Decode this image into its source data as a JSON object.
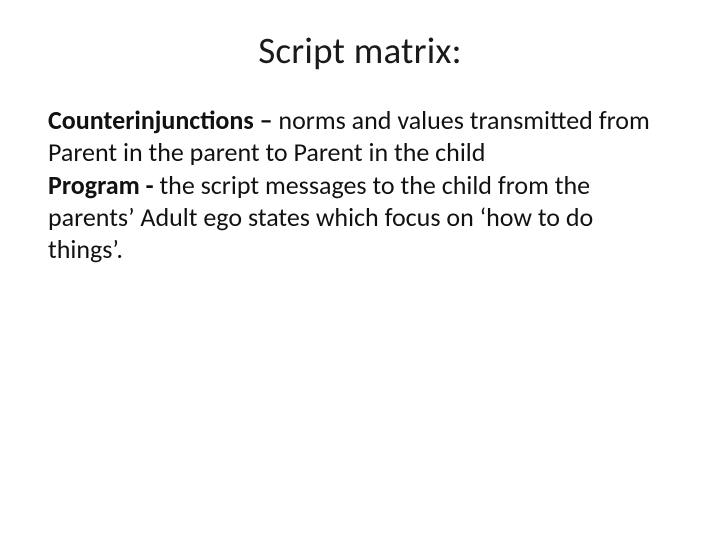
{
  "title": "Script matrix:",
  "items": [
    {
      "term": "Counterinjunctions – ",
      "definition": "norms and values transmitted from Parent in the parent to Parent in the child"
    },
    {
      "term": "Program -  ",
      "definition": "the script messages to the child from the parents’ Adult ego states which focus on ‘how to do things’."
    }
  ]
}
